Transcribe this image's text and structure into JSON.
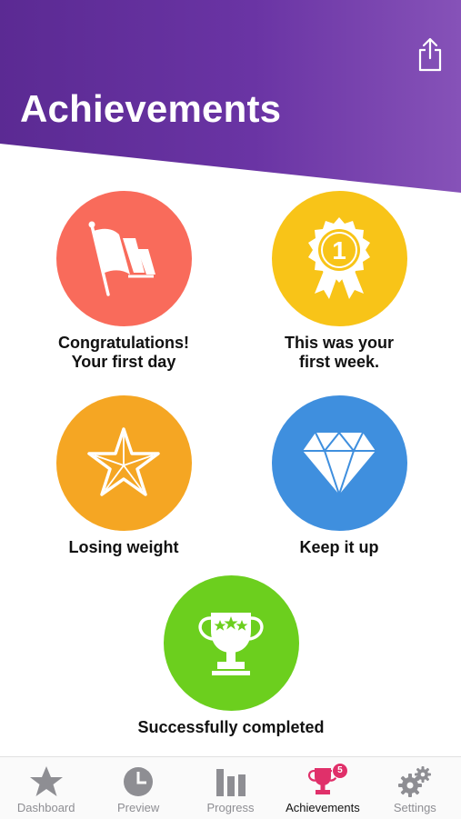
{
  "header": {
    "title": "Achievements"
  },
  "badges": [
    {
      "label": "Congratulations!\nYour first day",
      "color": "#f96b5b",
      "icon": "flags-icon"
    },
    {
      "label": "This was your\nfirst week.",
      "color": "#f8c418",
      "icon": "medal-ribbon-icon",
      "medal_number": "1"
    },
    {
      "label": "Losing weight",
      "color": "#f5a623",
      "icon": "star-icon"
    },
    {
      "label": "Keep it up",
      "color": "#3f8fde",
      "icon": "diamond-icon"
    },
    {
      "label": "Successfully completed",
      "color": "#6ccf1e",
      "icon": "trophy-icon"
    }
  ],
  "tabbar": {
    "active_color": "#e0306a",
    "inactive_color": "#8e8e93",
    "items": [
      {
        "label": "Dashboard",
        "icon": "star-icon"
      },
      {
        "label": "Preview",
        "icon": "clock-icon"
      },
      {
        "label": "Progress",
        "icon": "bar-chart-icon"
      },
      {
        "label": "Achievements",
        "icon": "trophy-icon",
        "badge_count": "5",
        "active": true
      },
      {
        "label": "Settings",
        "icon": "gears-icon"
      }
    ]
  }
}
